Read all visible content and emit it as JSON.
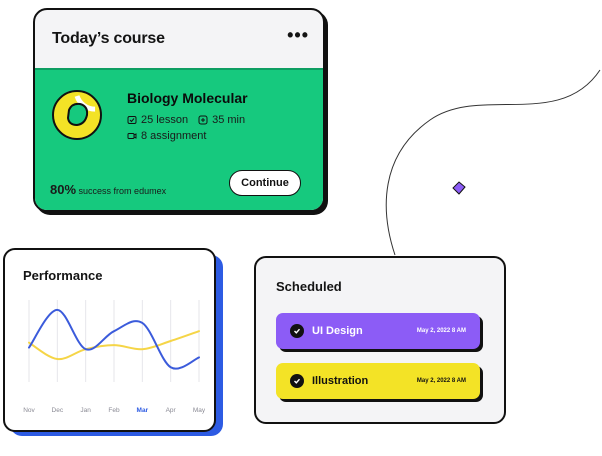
{
  "course_card": {
    "title": "Today’s course",
    "more": "•••",
    "course_name": "Biology Molecular",
    "lessons": "25 lesson",
    "duration": "35 min",
    "assignments": "8 assignment",
    "success_percent": "80%",
    "success_text": "success from edumex",
    "continue_label": "Continue",
    "progress": 0.8
  },
  "performance": {
    "title": "Performance"
  },
  "chart_data": {
    "type": "line",
    "title": "Performance",
    "categories": [
      "Nov",
      "Dec",
      "Jan",
      "Feb",
      "Mar",
      "Apr",
      "May"
    ],
    "highlight_category": "Mar",
    "series": [
      {
        "color": "#3b5bdb",
        "values": [
          42,
          88,
          40,
          62,
          72,
          18,
          30
        ]
      },
      {
        "color": "#f5d547",
        "values": [
          48,
          28,
          40,
          45,
          40,
          50,
          62
        ]
      }
    ],
    "ylim": [
      0,
      100
    ],
    "grid": "vertical"
  },
  "scheduled": {
    "title": "Scheduled",
    "items": [
      {
        "label": "UI Design",
        "date": "May 2, 2022 8 AM",
        "color": "#8c5cf6"
      },
      {
        "label": "Illustration",
        "date": "May 2, 2022 8 AM",
        "color": "#f3e326"
      }
    ]
  },
  "colors": {
    "green": "#16c97e",
    "blue_shadow": "#2d5be3",
    "purple": "#8c5cf6",
    "yellow": "#f3e326"
  }
}
